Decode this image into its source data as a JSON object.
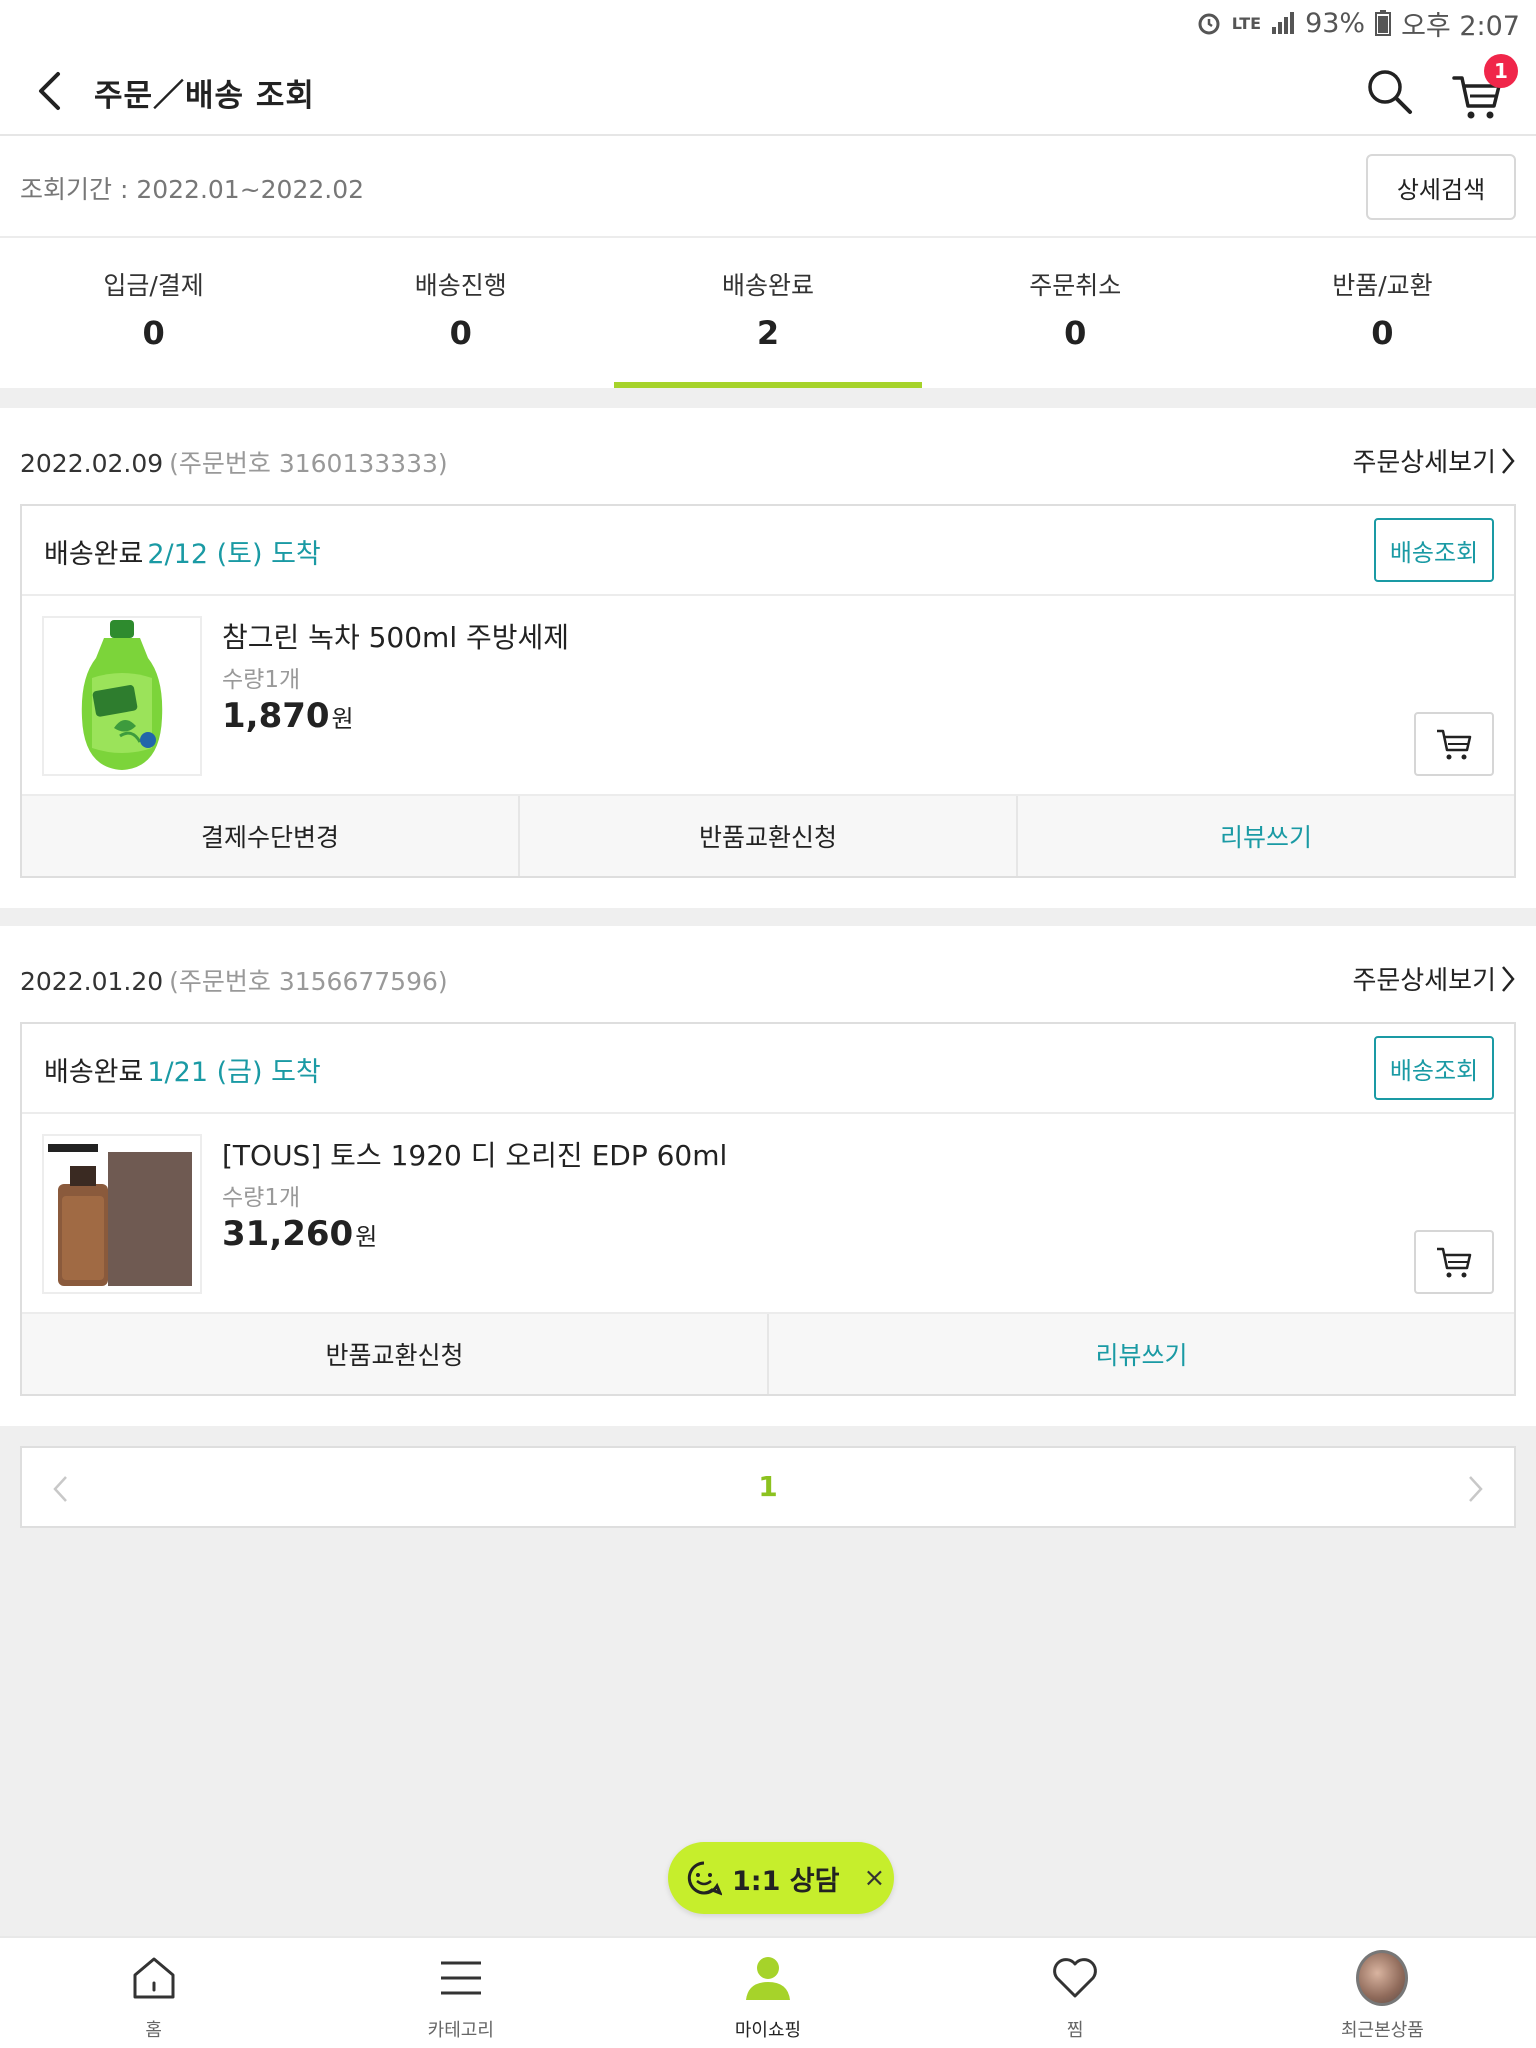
{
  "status_bar": {
    "network": "LTE",
    "battery": "93%",
    "time": "오후 2:07"
  },
  "header": {
    "title": "주문／배송 조회",
    "cart_count": "1"
  },
  "period": {
    "label": "조회기간 : 2022.01~2022.02",
    "detail_search": "상세검색"
  },
  "tabs": [
    {
      "label": "입금/결제",
      "count": "0"
    },
    {
      "label": "배송진행",
      "count": "0"
    },
    {
      "label": "배송완료",
      "count": "2"
    },
    {
      "label": "주문취소",
      "count": "0"
    },
    {
      "label": "반품/교환",
      "count": "0"
    }
  ],
  "orders": [
    {
      "date": "2022.02.09",
      "order_no": "(주문번호 3160133333)",
      "detail_link": "주문상세보기",
      "status": "배송완료",
      "arrival": "2/12 (토) 도착",
      "track_label": "배송조회",
      "product": {
        "name": "참그린 녹차 500ml 주방세제",
        "qty": "수량1개",
        "price": "1,870",
        "currency": "원"
      },
      "actions": [
        "결제수단변경",
        "반품교환신청",
        "리뷰쓰기"
      ]
    },
    {
      "date": "2022.01.20",
      "order_no": "(주문번호 3156677596)",
      "detail_link": "주문상세보기",
      "status": "배송완료",
      "arrival": "1/21 (금) 도착",
      "track_label": "배송조회",
      "product": {
        "name": "[TOUS] 토스 1920 디 오리진 EDP 60ml",
        "qty": "수량1개",
        "price": "31,260",
        "currency": "원"
      },
      "actions": [
        "반품교환신청",
        "리뷰쓰기"
      ]
    }
  ],
  "pagination": {
    "current": "1"
  },
  "chat": {
    "label": "1:1 상담",
    "close": "×"
  },
  "bottom_nav": [
    {
      "label": "홈",
      "icon": "home-icon"
    },
    {
      "label": "카테고리",
      "icon": "menu-icon"
    },
    {
      "label": "마이쇼핑",
      "icon": "person-icon"
    },
    {
      "label": "찜",
      "icon": "heart-icon"
    },
    {
      "label": "최근본상품",
      "icon": "recent-product-thumbnail"
    }
  ],
  "colors": {
    "accent_green": "#a6d32a",
    "teal": "#1a9aa4",
    "badge_red": "#f0264a",
    "chat_bg": "#c6ee2c"
  }
}
